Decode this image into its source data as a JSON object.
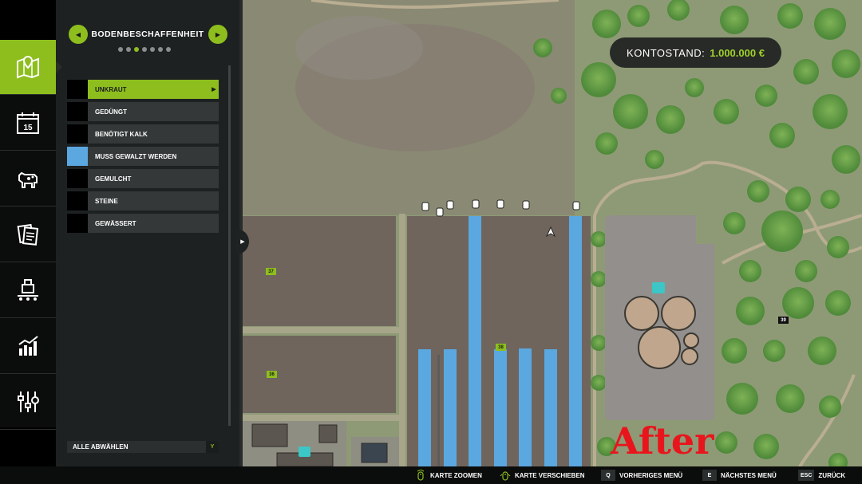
{
  "panel": {
    "title": "BODENBESCHAFFENHEIT",
    "page_dots": 7,
    "active_dot": 2,
    "prev_icon": "chevron-left-icon",
    "next_icon": "chevron-right-icon",
    "filters": [
      {
        "label": "UNKRAUT",
        "color": "#000000",
        "selected": true
      },
      {
        "label": "GEDÜNGT",
        "color": "#000000",
        "selected": false
      },
      {
        "label": "BENÖTIGT KALK",
        "color": "#000000",
        "selected": false
      },
      {
        "label": "MUSS GEWALZT WERDEN",
        "color": "#5ba7e0",
        "selected": false
      },
      {
        "label": "GEMULCHT",
        "color": "#000000",
        "selected": false
      },
      {
        "label": "STEINE",
        "color": "#000000",
        "selected": false
      },
      {
        "label": "GEWÄSSERT",
        "color": "#000000",
        "selected": false
      }
    ],
    "deselect_label": "ALLE ABWÄHLEN",
    "deselect_key": "Y"
  },
  "nav": {
    "items": [
      {
        "name": "map",
        "icon": "map-pin-icon",
        "active": true
      },
      {
        "name": "calendar",
        "icon": "calendar-icon",
        "label": "15",
        "active": false
      },
      {
        "name": "animals",
        "icon": "cow-icon",
        "active": false
      },
      {
        "name": "contracts",
        "icon": "documents-icon",
        "active": false
      },
      {
        "name": "production",
        "icon": "production-icon",
        "active": false
      },
      {
        "name": "statistics",
        "icon": "chart-icon",
        "active": false
      },
      {
        "name": "settings",
        "icon": "sliders-icon",
        "active": false
      }
    ]
  },
  "balance": {
    "label": "KONTOSTAND:",
    "value": "1.000.000 €"
  },
  "map": {
    "field_numbers": [
      "37",
      "38",
      "36",
      "39"
    ],
    "stamp_text": "After",
    "overlay_color": "#5ba7e0",
    "field_color": "#6f655d"
  },
  "bottom_hints": [
    {
      "key": "",
      "icon": "mouse-zoom-icon",
      "label": "KARTE ZOOMEN"
    },
    {
      "key": "",
      "icon": "mouse-move-icon",
      "label": "KARTE VERSCHIEBEN"
    },
    {
      "key": "Q",
      "label": "VORHERIGES MENÜ"
    },
    {
      "key": "E",
      "label": "NÄCHSTES MENÜ"
    },
    {
      "key": "ESC",
      "label": "ZURÜCK"
    }
  ]
}
